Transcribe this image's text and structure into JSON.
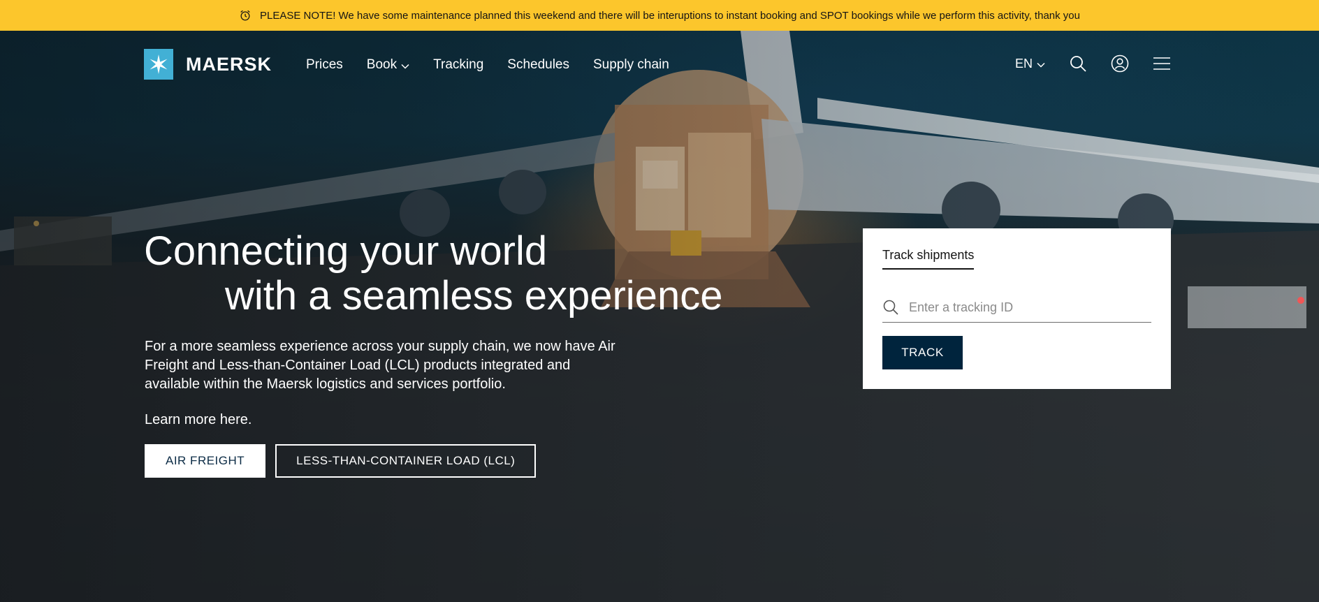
{
  "notice": {
    "text": "PLEASE NOTE! We have some maintenance planned this weekend and there will be interuptions to instant booking and SPOT bookings while we perform this activity, thank you",
    "icon": "alarm-clock-icon",
    "background": "#fcc62c"
  },
  "header": {
    "brand": "MAERSK",
    "brand_color": "#42b0d5",
    "nav": [
      {
        "label": "Prices"
      },
      {
        "label": "Book",
        "has_dropdown": true
      },
      {
        "label": "Tracking"
      },
      {
        "label": "Schedules"
      },
      {
        "label": "Supply chain"
      }
    ],
    "language": "EN",
    "icons": [
      "search-icon",
      "user-account-icon",
      "hamburger-menu-icon"
    ]
  },
  "hero": {
    "headline_line1": "Connecting your world",
    "headline_line2": "with a seamless experience",
    "body": "For a more seamless experience across your supply chain, we now have Air Freight and Less-than-Container Load (LCL) products integrated and available within the Maersk logistics and services portfolio.",
    "learn_more": "Learn more here.",
    "buttons": {
      "air_freight": "AIR FREIGHT",
      "lcl": "LESS-THAN-CONTAINER LOAD (LCL)"
    }
  },
  "track": {
    "tab_label": "Track shipments",
    "placeholder": "Enter a tracking ID",
    "value": "",
    "button": "TRACK",
    "button_color": "#00243d"
  }
}
